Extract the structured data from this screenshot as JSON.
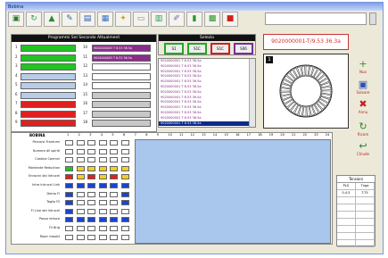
{
  "window": {
    "title": "Bobina"
  },
  "toolbar": {
    "icons": [
      "monitor-icon",
      "refresh-icon",
      "chart-icon",
      "edit-icon",
      "layers-icon",
      "grid-icon",
      "key-icon",
      "document-icon",
      "calendar-icon",
      "pencil-icon",
      "graph-icon",
      "calculator-icon",
      "stop-icon"
    ]
  },
  "top_input": {
    "value": ""
  },
  "slots_panel": {
    "header": "Programmi Sel Secondo Attualment"
  },
  "slots_left": [
    {
      "n": "1",
      "color": "#22c422"
    },
    {
      "n": "2",
      "color": "#22c422"
    },
    {
      "n": "3",
      "color": "#22c422"
    },
    {
      "n": "4",
      "color": "#b8cce8"
    },
    {
      "n": "5",
      "color": "#b8cce8"
    },
    {
      "n": "6",
      "color": "#b8cce8"
    },
    {
      "n": "7",
      "color": "#e02020"
    },
    {
      "n": "8",
      "color": "#e02020"
    },
    {
      "n": "9",
      "color": "#e02020"
    }
  ],
  "slots_right": [
    {
      "n": "10",
      "color": "#8a2d8a",
      "text": "9020000003 T 6.53 36.5a"
    },
    {
      "n": "11",
      "color": "#8a2d8a",
      "text": "9020000003 T 6.53 36.5a"
    },
    {
      "n": "12",
      "color": "#ffffff",
      "text": ""
    },
    {
      "n": "13",
      "color": "#ffffff",
      "text": ""
    },
    {
      "n": "14",
      "color": "#ffffff",
      "text": ""
    },
    {
      "n": "15",
      "color": "#c8c8c8",
      "text": ""
    },
    {
      "n": "16",
      "color": "#c8c8c8",
      "text": ""
    },
    {
      "n": "17",
      "color": "#c8c8c8",
      "text": ""
    },
    {
      "n": "18",
      "color": "#c8c8c8",
      "text": ""
    }
  ],
  "selection": {
    "header": "Selezio",
    "buttons": [
      {
        "label": "S1",
        "color": "#22a822"
      },
      {
        "label": "S1C",
        "color": "#22a822"
      },
      {
        "label": "S1C",
        "color": "#d02020"
      },
      {
        "label": "S06",
        "color": "#7a2d9a"
      }
    ]
  },
  "list_items": [
    "9020000001 T 6.53 36.5a",
    "9020000001 T 6.53 36.5a",
    "9020000001 T 6.53 36.5a",
    "9020000001 T 6.53 36.5a",
    "9020000001 T 6.53 36.5a",
    "9020000001 T 6.53 36.5a",
    "9020000001 T 6.53 36.5a",
    "9020000001 T 6.53 36.5a",
    "9020000001 T 6.53 36.5a",
    "9020000001 T 6.53 36.5a",
    "9020000001 T 6.53 36.5a",
    "9020000001 T 6.53 36.5a",
    "9020000001 T 6.53 36.5a"
  ],
  "id_display": "9020000001-T/9.53 36.3a",
  "wheel": {
    "label": "1"
  },
  "side_buttons": [
    {
      "label": "Nuo",
      "icon": "+",
      "color": "#2a9a2a"
    },
    {
      "label": "Salvare",
      "icon": "▣",
      "color": "#2d4fb0"
    },
    {
      "label": "Annu",
      "icon": "✖",
      "color": "#c02020"
    },
    {
      "label": "Ricom",
      "icon": "↻",
      "color": "#2a8a2a"
    },
    {
      "label": "Chiude",
      "icon": "↩",
      "color": "#2a7a2a"
    }
  ],
  "grid": {
    "header": "BOBINA",
    "columns": [
      "1",
      "2",
      "3",
      "4",
      "5",
      "6",
      "7",
      "8",
      "9",
      "10",
      "11",
      "12",
      "13",
      "14",
      "15",
      "16",
      "17",
      "18",
      "19",
      "20",
      "21",
      "22",
      "23",
      "24"
    ],
    "row_labels": [
      "Percorsi Frantumi",
      "Numero dll spiriti",
      "Castina Carenni",
      "Montante Reduction",
      "Enrocini dal Intrucel",
      "Intro Intrucel Link",
      "Demo Fl",
      "Taglio Fil",
      "Fl Line dal Intrucel",
      "Passo reduce",
      "Fil Brig",
      "Riper riassitt"
    ]
  },
  "table": {
    "header": "Tensioni",
    "cols": [
      "PLG",
      "Tnga"
    ],
    "rows": [
      [
        "0.4.5",
        "T.75"
      ],
      [
        "",
        ""
      ],
      [
        "",
        ""
      ],
      [
        "",
        ""
      ],
      [
        "",
        ""
      ],
      [
        "",
        ""
      ],
      [
        "",
        ""
      ],
      [
        "",
        ""
      ]
    ]
  }
}
